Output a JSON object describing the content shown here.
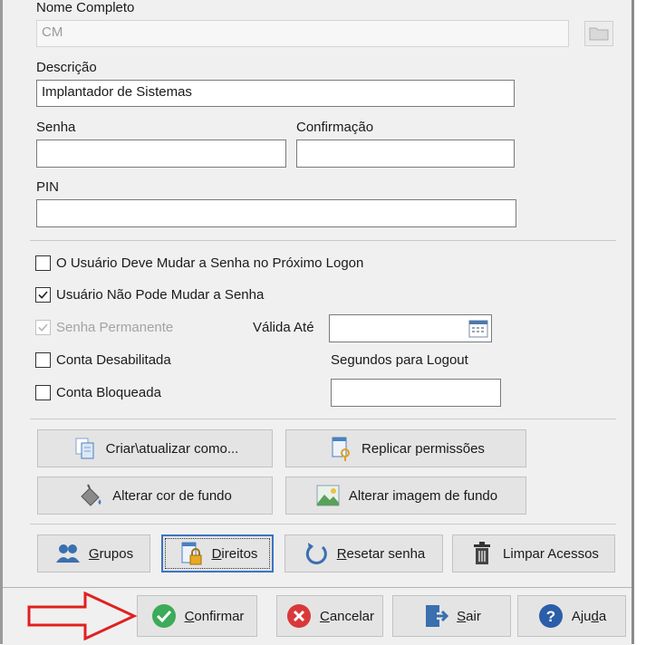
{
  "form": {
    "full_name_label": "Nome Completo",
    "full_name_value": "CM",
    "description_label": "Descrição",
    "description_value": "Implantador de Sistemas",
    "password_label": "Senha",
    "password_value": "",
    "confirm_label": "Confirmação",
    "confirm_value": "",
    "pin_label": "PIN",
    "pin_value": "",
    "valid_until_label": "Válida Até",
    "valid_until_value": "",
    "logout_seconds_label": "Segundos para Logout",
    "logout_seconds_value": ""
  },
  "options": {
    "must_change": {
      "label": "O Usuário Deve Mudar a Senha no Próximo Logon",
      "checked": false
    },
    "cannot_change": {
      "label": "Usuário Não Pode Mudar a Senha",
      "checked": true
    },
    "permanent": {
      "label": "Senha Permanente",
      "checked": true,
      "disabled": true
    },
    "disabled_account": {
      "label": "Conta Desabilitada",
      "checked": false
    },
    "locked_account": {
      "label": "Conta Bloqueada",
      "checked": false
    }
  },
  "actions": {
    "create_update_label": "Criar\\atualizar como...",
    "replicate_label": "Replicar permissões",
    "bg_color_label": "Alterar cor de fundo",
    "bg_image_label": "Alterar imagem de fundo",
    "groups_first": "G",
    "groups_rest": "rupos",
    "rights_first": "D",
    "rights_rest": "ireitos",
    "reset_first": "R",
    "reset_rest": "esetar senha",
    "clear_access_label": "Limpar Acessos"
  },
  "footer": {
    "confirm_first": "C",
    "confirm_rest": "onfirmar",
    "cancel_first": "C",
    "cancel_rest": "ancelar",
    "exit_first": "S",
    "exit_rest": "air",
    "help_prefix": "Aju",
    "help_u": "d",
    "help_suffix": "a"
  },
  "colors": {
    "accent": "#3b74c2",
    "confirm_green": "#3cab5a",
    "cancel_red": "#d9383a",
    "help_blue": "#2a5ea8",
    "arrow_red": "#e02020"
  }
}
